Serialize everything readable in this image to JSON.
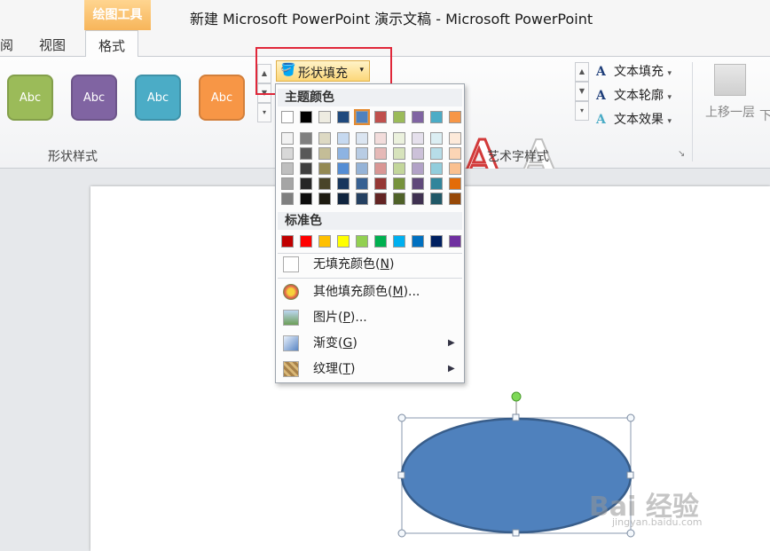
{
  "window": {
    "title": "新建 Microsoft PowerPoint 演示文稿 - Microsoft PowerPoint"
  },
  "context_tab": {
    "label": "绘图工具"
  },
  "tabs": [
    {
      "label": "阅"
    },
    {
      "label": "视图"
    },
    {
      "label": "格式",
      "active": true
    }
  ],
  "ribbon": {
    "shape_styles": {
      "label": "形状样式",
      "buttons": [
        {
          "label": "Abc",
          "color": "#9bbb59"
        },
        {
          "label": "Abc",
          "color": "#8064a2"
        },
        {
          "label": "Abc",
          "color": "#4bacc6"
        },
        {
          "label": "Abc",
          "color": "#f79646"
        }
      ]
    },
    "shape_fill": {
      "label": "形状填充"
    },
    "wordart": {
      "label": "艺术字样式",
      "samples": [
        {
          "label": "A"
        },
        {
          "label": "A"
        }
      ],
      "text_fill": "文本填充",
      "text_outline": "文本轮廓",
      "text_effects": "文本效果"
    },
    "arrange": {
      "bring_forward": "上移一层",
      "next": "下"
    }
  },
  "fill_menu": {
    "theme_header": "主题颜色",
    "theme_top": [
      "#ffffff",
      "#000000",
      "#eeece1",
      "#1f497d",
      "#4f81bd",
      "#c0504d",
      "#9bbb59",
      "#8064a2",
      "#4bacc6",
      "#f79646"
    ],
    "theme_shades": [
      [
        "#f2f2f2",
        "#7f7f7f",
        "#ddd9c3",
        "#c6d9f0",
        "#dbe5f1",
        "#f2dcdb",
        "#ebf1dd",
        "#e5e0ec",
        "#dbeef3",
        "#fdeada"
      ],
      [
        "#d8d8d8",
        "#595959",
        "#c4bd97",
        "#8db3e2",
        "#b8cce4",
        "#e5b9b7",
        "#d7e3bc",
        "#ccc1d9",
        "#b7dde8",
        "#fbd5b5"
      ],
      [
        "#bfbfbf",
        "#3f3f3f",
        "#938953",
        "#548dd4",
        "#95b3d7",
        "#d99694",
        "#c3d69b",
        "#b2a2c7",
        "#92cddc",
        "#fac08f"
      ],
      [
        "#a5a5a5",
        "#262626",
        "#494429",
        "#17365d",
        "#366092",
        "#953734",
        "#76923c",
        "#5f497a",
        "#31859b",
        "#e36c09"
      ],
      [
        "#7f7f7f",
        "#0c0c0c",
        "#1d1b10",
        "#0f243e",
        "#244061",
        "#632423",
        "#4f6128",
        "#3f3151",
        "#205867",
        "#974806"
      ]
    ],
    "standard_header": "标准色",
    "standard": [
      "#c00000",
      "#ff0000",
      "#ffc000",
      "#ffff00",
      "#92d050",
      "#00b050",
      "#00b0f0",
      "#0070c0",
      "#002060",
      "#7030a0"
    ],
    "no_fill": {
      "text": "无填充颜色(",
      "key": "N",
      "end": ")"
    },
    "more_colors": {
      "text": "其他填充颜色(",
      "key": "M",
      "end": ")..."
    },
    "picture": {
      "text": "图片(",
      "key": "P",
      "end": ")..."
    },
    "gradient": {
      "text": "渐变(",
      "key": "G",
      "end": ")"
    },
    "texture": {
      "text": "纹理(",
      "key": "T",
      "end": ")"
    }
  },
  "shape": {
    "fill": "#4f81bd",
    "stroke": "#385d8a"
  },
  "watermark": {
    "text": "Bai 经验",
    "sub": "jingyan.baidu.com"
  }
}
